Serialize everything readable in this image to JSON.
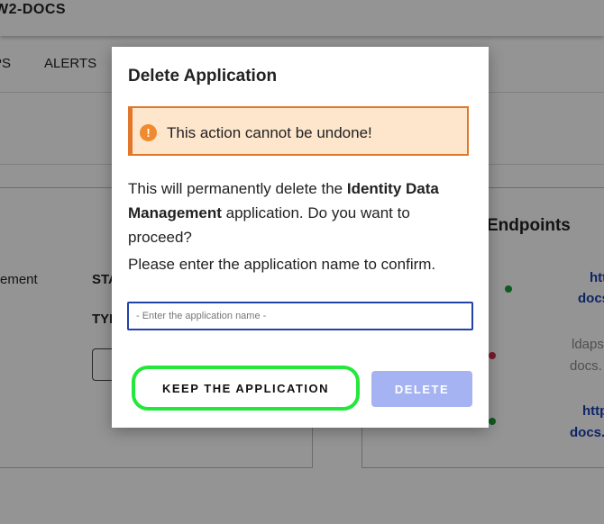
{
  "app": {
    "brand": "W2-DOCS"
  },
  "nav": {
    "items": [
      "PS",
      "ALERTS"
    ]
  },
  "background": {
    "left_panel": {
      "label_fragment": "ement",
      "status_fragment": "STA",
      "type_fragment": "TYI"
    },
    "right_panel": {
      "title_fragment": "Endpoints",
      "rows": [
        {
          "line1": "htt",
          "line2": "docs",
          "status": "green"
        },
        {
          "line1": "ldaps",
          "line2": "docs.",
          "status": "red"
        },
        {
          "line1": "http",
          "line2": "docs.",
          "status": "green"
        }
      ]
    }
  },
  "modal": {
    "title": "Delete Application",
    "warning": {
      "icon": "exclamation-icon",
      "text": "This action cannot be undone!"
    },
    "body_prefix": "This will permanently delete the ",
    "app_name": "Identity Data Management",
    "body_suffix": " application. Do you want to proceed?",
    "confirm_prompt": "Please enter the application name to confirm.",
    "input": {
      "value": "",
      "placeholder": "- Enter the application name -"
    },
    "keep_label": "KEEP THE APPLICATION",
    "delete_label": "DELETE"
  },
  "colors": {
    "warning_border": "#e2762b",
    "warning_bg": "#fde6cc",
    "keep_highlight": "#22e83b",
    "delete_disabled": "#a5b3f3",
    "link": "#1a3fb0"
  }
}
